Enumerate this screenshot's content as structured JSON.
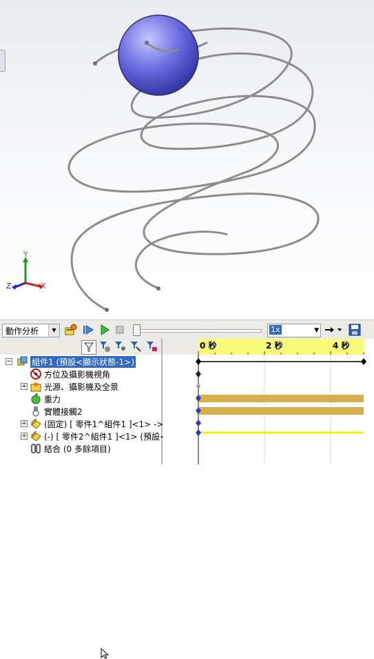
{
  "toolbar": {
    "study_label": "動作分析",
    "speed_value": "1x",
    "icons": [
      "calculate-icon",
      "play-from-start-icon",
      "play-icon",
      "stop-icon",
      "arrow-right-icon",
      "save-icon"
    ]
  },
  "timeline": {
    "labels": [
      "0 秒",
      "2 秒",
      "4 秒"
    ],
    "ruler_color": "#fafa7a",
    "bar_color_brown": "#d6ae4a",
    "bar_color_yellow": "#f0f000"
  },
  "tree": {
    "items": [
      {
        "label": "組件1  (預設<顯示狀態-1>)",
        "expander": "−",
        "selected": true
      },
      {
        "label": "方位及攝影機視角"
      },
      {
        "label": "光源、攝影機及全景",
        "expander": "+"
      },
      {
        "label": "重力"
      },
      {
        "label": "實體接觸2"
      },
      {
        "label": "(固定) [ 零件1^組件1 ]<1> -> (",
        "expander": "+"
      },
      {
        "label": "(-) [ 零件2^組件1 ]<1> (預設<",
        "expander": "+"
      },
      {
        "label": "結合 (0 多餘項目)"
      }
    ]
  },
  "axes": {
    "x": "X",
    "y": "Y",
    "z": "Z"
  },
  "colors": {
    "sphere": "#6a6ce0",
    "spring": "#8c8c8c",
    "selection": "#316ac5"
  }
}
